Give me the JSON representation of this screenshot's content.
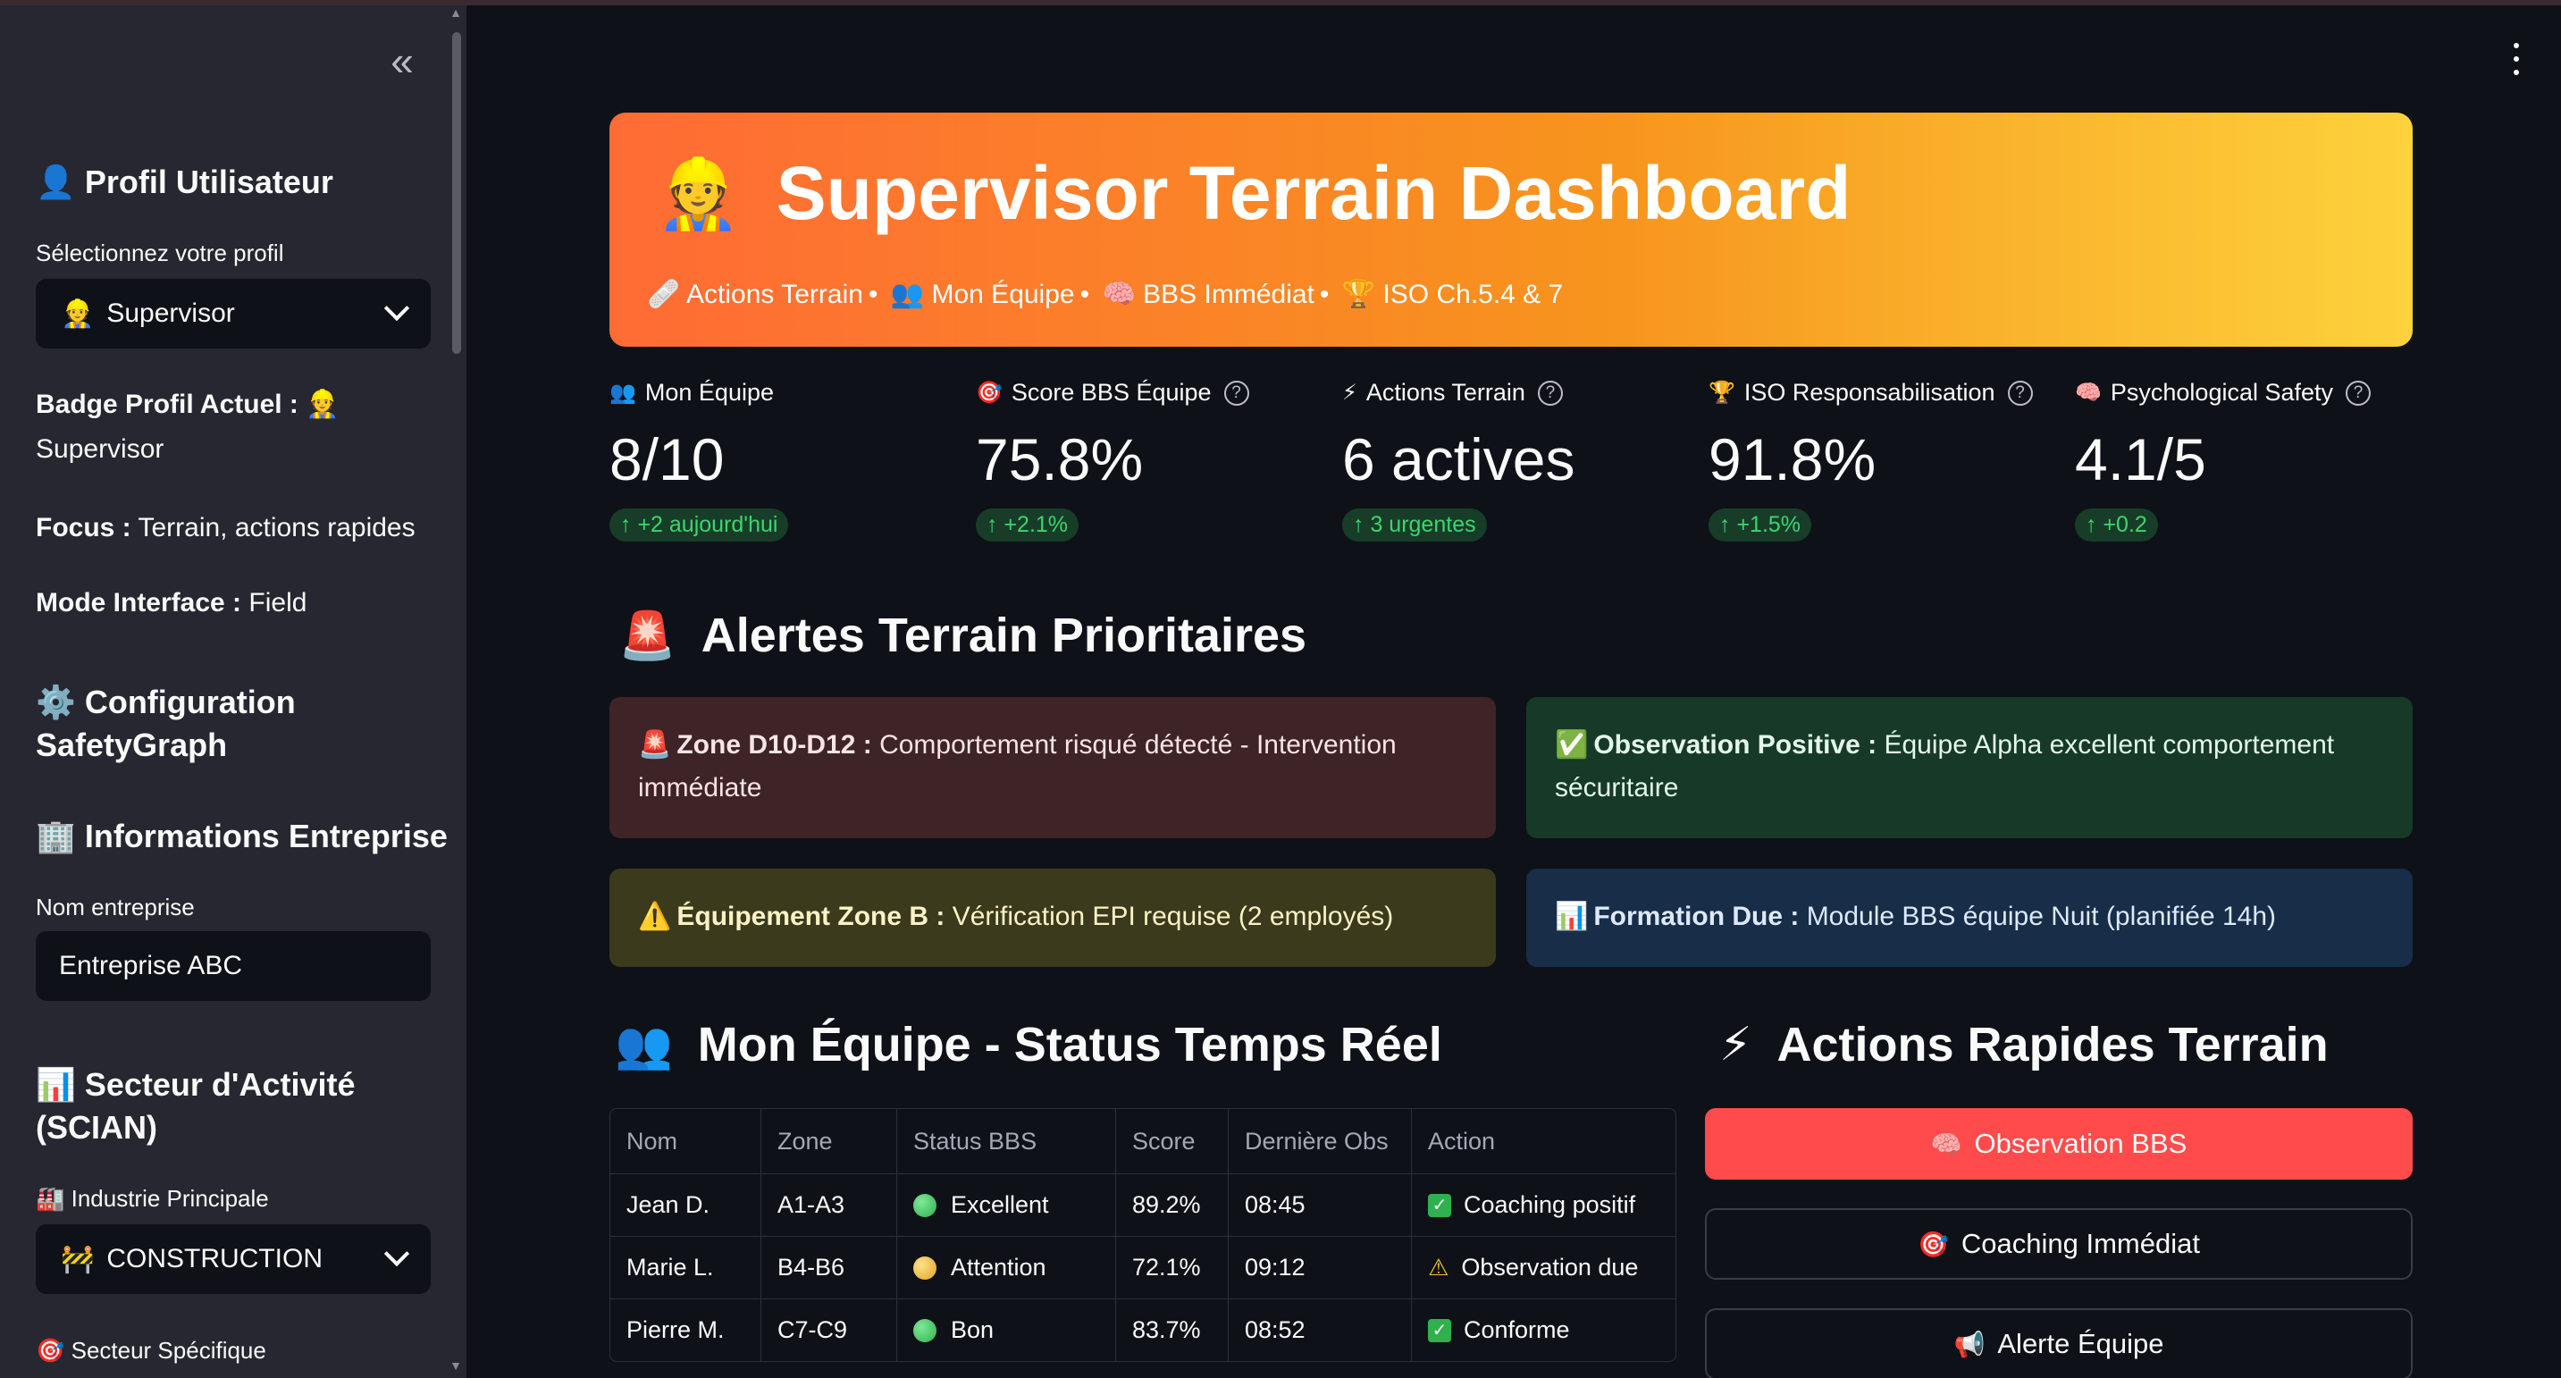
{
  "sidebar": {
    "profile_title": "Profil Utilisateur",
    "profile_icon": "👤",
    "select_profile_label": "Sélectionnez votre profil",
    "profile_select": {
      "icon": "👷",
      "value": "Supervisor"
    },
    "badge_label": "Badge Profil Actuel :",
    "badge_icon": "👷",
    "badge_value": "Supervisor",
    "focus_label": "Focus :",
    "focus_value": "Terrain, actions rapides",
    "mode_label": "Mode Interface :",
    "mode_value": "Field",
    "config_title_line1": "Configuration",
    "config_title_line2": "SafetyGraph",
    "config_icon": "⚙️",
    "company_title": "Informations Entreprise",
    "company_icon": "🏢",
    "company_name_label": "Nom entreprise",
    "company_name_value": "Entreprise ABC",
    "sector_title_line1": "Secteur d'Activité",
    "sector_title_line2": "(SCIAN)",
    "sector_icon": "📊",
    "industry_label": "Industrie Principale",
    "industry_icon": "🏭",
    "industry_select": {
      "icon": "🚧",
      "value": "CONSTRUCTION"
    },
    "specific_sector_label": "Secteur Spécifique",
    "specific_sector_icon": "🎯"
  },
  "banner": {
    "icon": "👷",
    "title": "Supervisor Terrain Dashboard",
    "items": [
      {
        "icon": "🩹",
        "text": "Actions Terrain"
      },
      {
        "icon": "👥",
        "text": "Mon Équipe"
      },
      {
        "icon": "🧠",
        "text": "BBS Immédiat"
      },
      {
        "icon": "🏆",
        "text": "ISO Ch.5.4 & 7"
      }
    ],
    "separator": "•"
  },
  "metrics": [
    {
      "icon": "👥",
      "label": "Mon Équipe",
      "help": false,
      "value": "8/10",
      "delta": "+2 aujourd'hui"
    },
    {
      "icon": "🎯",
      "label": "Score BBS Équipe",
      "help": true,
      "value": "75.8%",
      "delta": "+2.1%"
    },
    {
      "icon": "⚡",
      "label": "Actions Terrain",
      "help": true,
      "value": "6 actives",
      "delta": "3 urgentes"
    },
    {
      "icon": "🏆",
      "label": "ISO Responsabilisation",
      "help": true,
      "value": "91.8%",
      "delta": "+1.5%"
    },
    {
      "icon": "🧠",
      "label": "Psychological Safety",
      "help": true,
      "value": "4.1/5",
      "delta": "+0.2"
    }
  ],
  "alerts_section": {
    "icon": "🚨",
    "title": "Alertes Terrain Prioritaires"
  },
  "alerts": [
    {
      "icon": "🚨",
      "bold": "Zone D10-D12 :",
      "text": " Comportement risqué détecté - Intervention immédiate"
    },
    {
      "icon": "✅",
      "bold": "Observation Positive :",
      "text": " Équipe Alpha excellent comportement sécuritaire"
    },
    {
      "icon": "⚠️",
      "bold": "Équipement Zone B :",
      "text": " Vérification EPI requise (2 employés)"
    },
    {
      "icon": "📊",
      "bold": "Formation Due :",
      "text": " Module BBS équipe Nuit (planifiée 14h)"
    }
  ],
  "team_section": {
    "icon": "👥",
    "title": "Mon Équipe - Status Temps Réel"
  },
  "team_table": {
    "columns": [
      "Nom",
      "Zone",
      "Status BBS",
      "Score",
      "Dernière Obs",
      "Action"
    ],
    "rows": [
      {
        "nom": "Jean D.",
        "zone": "A1-A3",
        "status": "Excellent",
        "status_color": "#2fb14d",
        "score": "89.2%",
        "obs": "08:45",
        "action": "Coaching positif",
        "action_icon": "check"
      },
      {
        "nom": "Marie L.",
        "zone": "B4-B6",
        "status": "Attention",
        "status_color": "#e0a522",
        "score": "72.1%",
        "obs": "09:12",
        "action": "Observation due",
        "action_icon": "warning"
      },
      {
        "nom": "Pierre M.",
        "zone": "C7-C9",
        "status": "Bon",
        "status_color": "#2fb14d",
        "score": "83.7%",
        "obs": "08:52",
        "action": "Conforme",
        "action_icon": "check"
      }
    ]
  },
  "actions_section": {
    "icon": "⚡",
    "title": "Actions Rapides Terrain"
  },
  "actions": [
    {
      "icon": "🧠",
      "label": "Observation BBS",
      "primary": true
    },
    {
      "icon": "🎯",
      "label": "Coaching Immédiat",
      "primary": false
    },
    {
      "icon": "📢",
      "label": "Alerte Équipe",
      "primary": false
    }
  ],
  "colors": {
    "accent": "#ff4b4b",
    "banner_start": "#ff6b35",
    "banner_end": "#fdd23c",
    "delta_green": "#3dd56d"
  }
}
